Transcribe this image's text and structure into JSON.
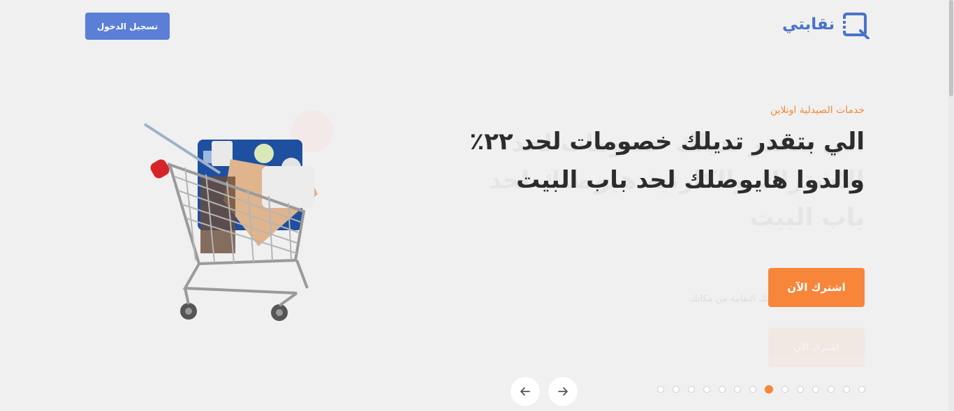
{
  "header": {
    "logo_text": "نقابتي",
    "login_label": "تسجيل الدخول"
  },
  "hero": {
    "eyebrow": "خدمات الصيدلية اونلاين",
    "headline": "الي بتقدر تديلك خصومات لحد ٢٢٪ والدوا هايوصلك لحد باب البيت",
    "cta_label": "اشترك الآن",
    "ghost_headline": "الي بتقدر تديلك خصومات لحد الاشتراك والكارنية هيوصلك لحد باب البيت",
    "ghost_subtitle": "امكنك الحصول علي خدماتك النقابية من مكانك",
    "ghost_cta_label": "اشترك الآن"
  },
  "carousel": {
    "total_slides": 14,
    "active_index": 7,
    "prev_icon": "arrow-left-icon",
    "next_icon": "arrow-right-icon"
  },
  "colors": {
    "accent": "#f7863a",
    "brand": "#5b7fd6",
    "logo": "#4a72c9",
    "headline": "#2c2c2c"
  }
}
